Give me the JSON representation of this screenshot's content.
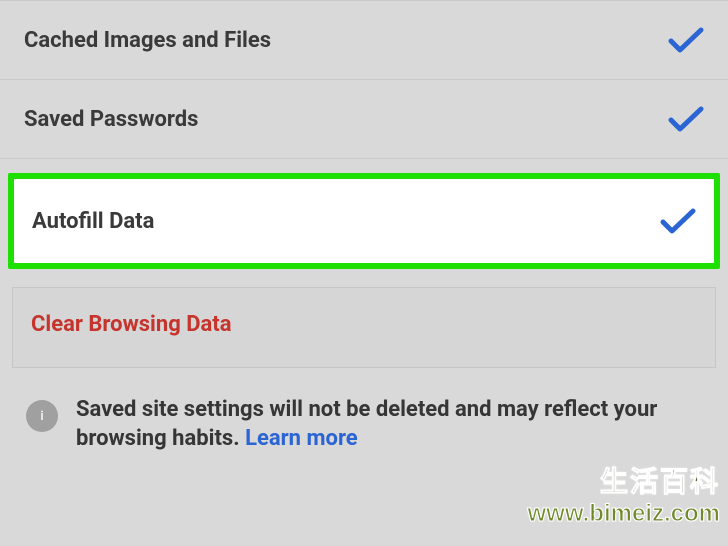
{
  "items": {
    "cached": {
      "label": "Cached Images and Files"
    },
    "passwords": {
      "label": "Saved Passwords"
    },
    "autofill": {
      "label": "Autofill Data"
    }
  },
  "clear": {
    "label": "Clear Browsing Data"
  },
  "info": {
    "text": "Saved site settings will not be deleted and may reflect your browsing habits. ",
    "link": "Learn more"
  },
  "colors": {
    "check": "#2b64d3",
    "highlight": "#1de000",
    "danger": "#c5352d"
  },
  "watermark": {
    "text": "生活百科",
    "url": "www.bimeiz.com"
  }
}
